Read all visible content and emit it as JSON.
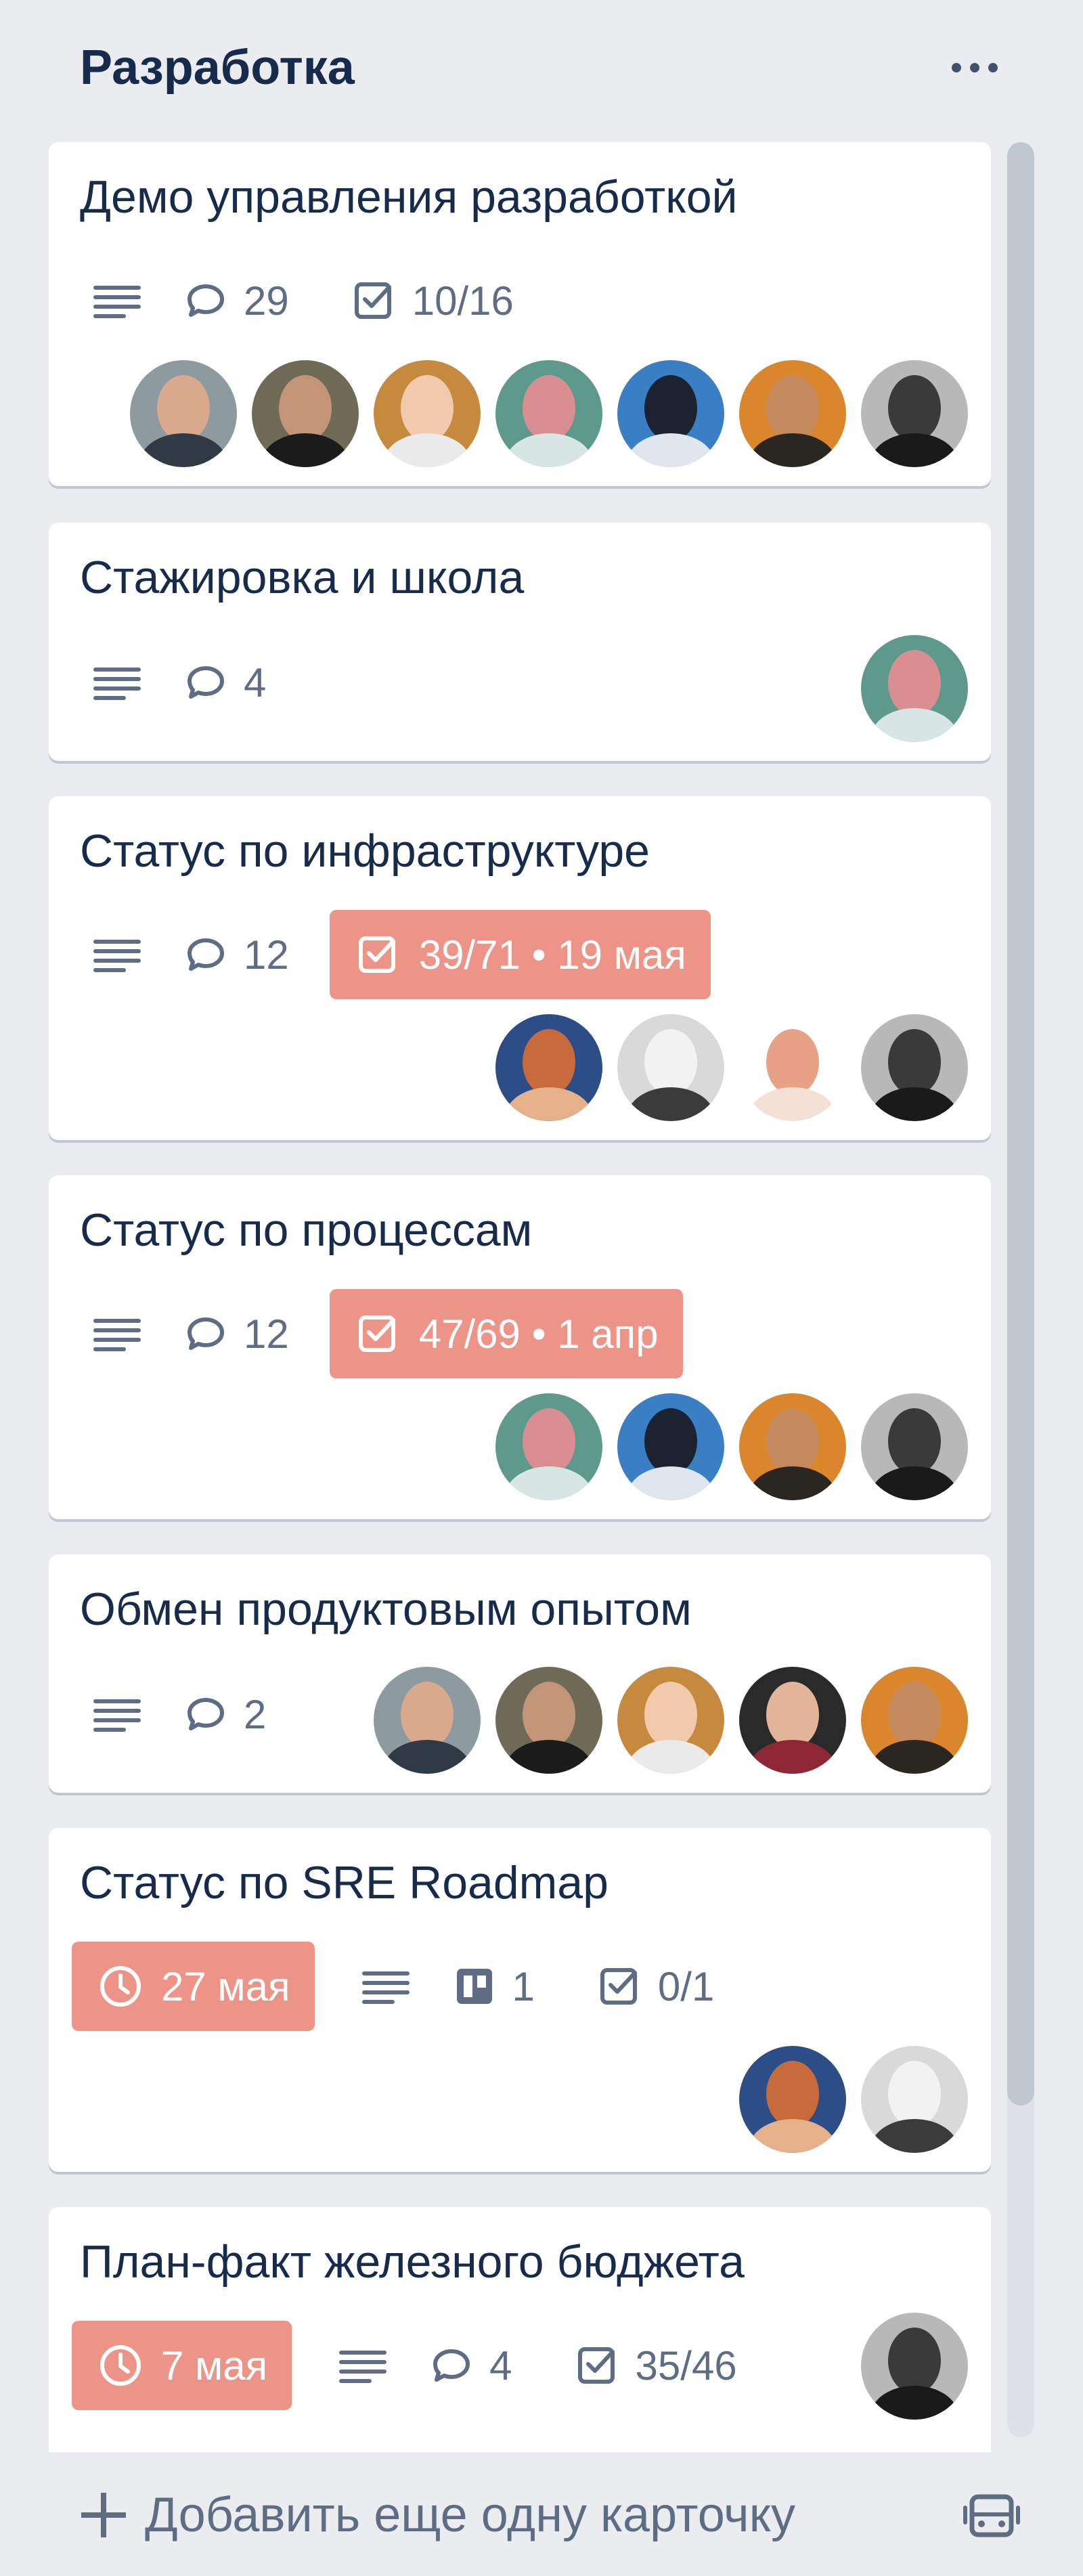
{
  "list": {
    "title": "Разработка",
    "more_icon": "ellipsis-icon",
    "add_card_label": "Добавить еще одну карточку",
    "add_icon": "plus-icon",
    "template_icon": "card-template-icon"
  },
  "colors": {
    "background": "#ebecf0",
    "card": "#ffffff",
    "overdue_badge": "#ec9488",
    "text": "#172b4d",
    "muted": "#5e6c84"
  },
  "cards": [
    {
      "title": "Демо управления разработкой",
      "comments": "29",
      "checklist": "10/16",
      "members": [
        "avatar-1",
        "avatar-2",
        "avatar-3",
        "avatar-4",
        "avatar-5",
        "avatar-6",
        "avatar-7"
      ]
    },
    {
      "title": "Стажировка и школа",
      "comments": "4",
      "members": [
        "avatar-4"
      ]
    },
    {
      "title": "Статус по инфраструктуре",
      "comments": "12",
      "checklist_due": "39/71 • 19 мая",
      "members": [
        "avatar-8",
        "avatar-9",
        "avatar-10",
        "avatar-7"
      ]
    },
    {
      "title": "Статус по процессам",
      "comments": "12",
      "checklist_due": "47/69 • 1 апр",
      "members": [
        "avatar-4",
        "avatar-5",
        "avatar-6",
        "avatar-7"
      ]
    },
    {
      "title": "Обмен продуктовым опытом",
      "comments": "2",
      "members": [
        "avatar-1",
        "avatar-2",
        "avatar-3",
        "avatar-11",
        "avatar-6"
      ]
    },
    {
      "title": "Статус по SRE Roadmap",
      "due": "27 мая",
      "attachments": "1",
      "checklist": "0/1",
      "members": [
        "avatar-8",
        "avatar-9"
      ]
    },
    {
      "title": "План-факт железного бюджета",
      "due": "7 мая",
      "comments": "4",
      "checklist": "35/46",
      "members": [
        "avatar-7"
      ]
    }
  ]
}
